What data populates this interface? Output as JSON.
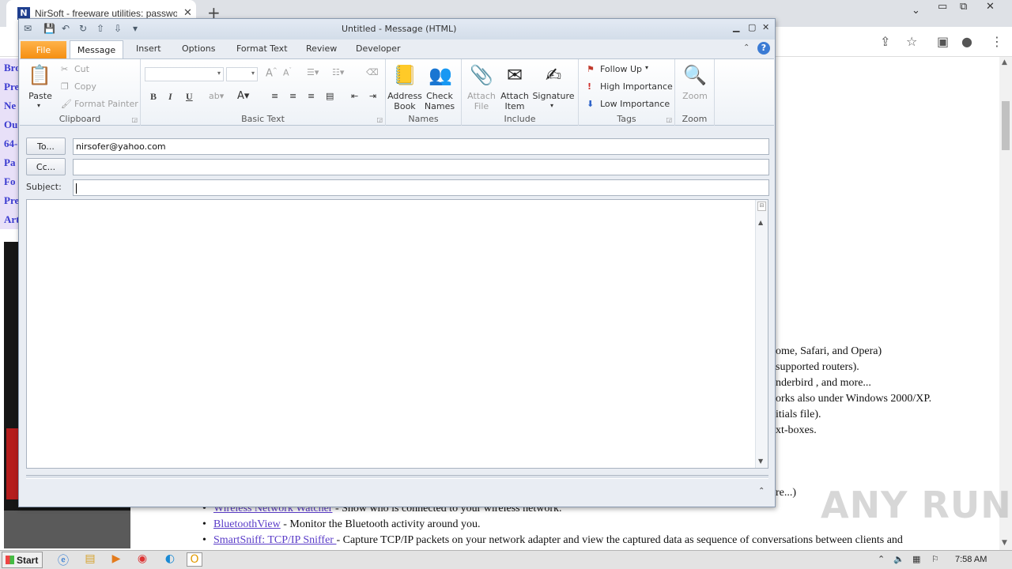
{
  "browser": {
    "tab_title": "NirSoft - freeware utilities: passwor",
    "tab_close": "✕",
    "new_tab": "+",
    "favicon_letter": "N",
    "left_nav": [
      "Bro",
      "Pre",
      "Ne",
      "Ou",
      "64-",
      "Pa",
      "Fo",
      "Pre",
      "Art"
    ],
    "page_lines": [
      "ome, Safari, and Opera)",
      "supported routers).",
      "nderbird , and more...",
      "orks also under Windows 2000/XP.",
      "itials file).",
      "xt-boxes.",
      "re...)"
    ],
    "list_items": [
      {
        "link": "Wireless Network Watcher",
        "text": " - Show who is connected to your wireless network."
      },
      {
        "link": "BluetoothView",
        "text": " - Monitor the Bluetooth activity around you."
      },
      {
        "link": "SmartSniff: TCP/IP Sniffer ",
        "text": " - Capture TCP/IP packets on your network adapter and view the captured data as sequence of conversations between clients and"
      }
    ],
    "watermark": "ANY RUN"
  },
  "outlook": {
    "title": "Untitled  -  Message (HTML)",
    "tabs": {
      "file": "File",
      "message": "Message",
      "insert": "Insert",
      "options": "Options",
      "format_text": "Format Text",
      "review": "Review",
      "developer": "Developer"
    },
    "help": "?",
    "clipboard": {
      "label": "Clipboard",
      "paste": "Paste",
      "cut": "Cut",
      "copy": "Copy",
      "format_painter": "Format Painter"
    },
    "basic_text": {
      "label": "Basic Text",
      "bold": "B",
      "italic": "I",
      "underline": "U"
    },
    "names": {
      "label": "Names",
      "address_book_1": "Address",
      "address_book_2": "Book",
      "check_names_1": "Check",
      "check_names_2": "Names"
    },
    "include": {
      "label": "Include",
      "attach_file_1": "Attach",
      "attach_file_2": "File",
      "attach_item_1": "Attach",
      "attach_item_2": "Item",
      "signature": "Signature"
    },
    "tags": {
      "label": "Tags",
      "follow_up": "Follow Up",
      "high_importance": "High Importance",
      "low_importance": "Low Importance"
    },
    "zoom": {
      "label": "Zoom",
      "zoom": "Zoom"
    },
    "header": {
      "to_label": "To...",
      "cc_label": "Cc...",
      "subject_label": "Subject:",
      "to_value": "nirsofer@yahoo.com",
      "cc_value": "",
      "subject_value": ""
    }
  },
  "taskbar": {
    "start": "Start",
    "clock": "7:58 AM"
  },
  "colors": {
    "file_tab": "#f58f12",
    "accent_blue": "#3b7bd4",
    "link_purple": "#5a3cc8"
  }
}
